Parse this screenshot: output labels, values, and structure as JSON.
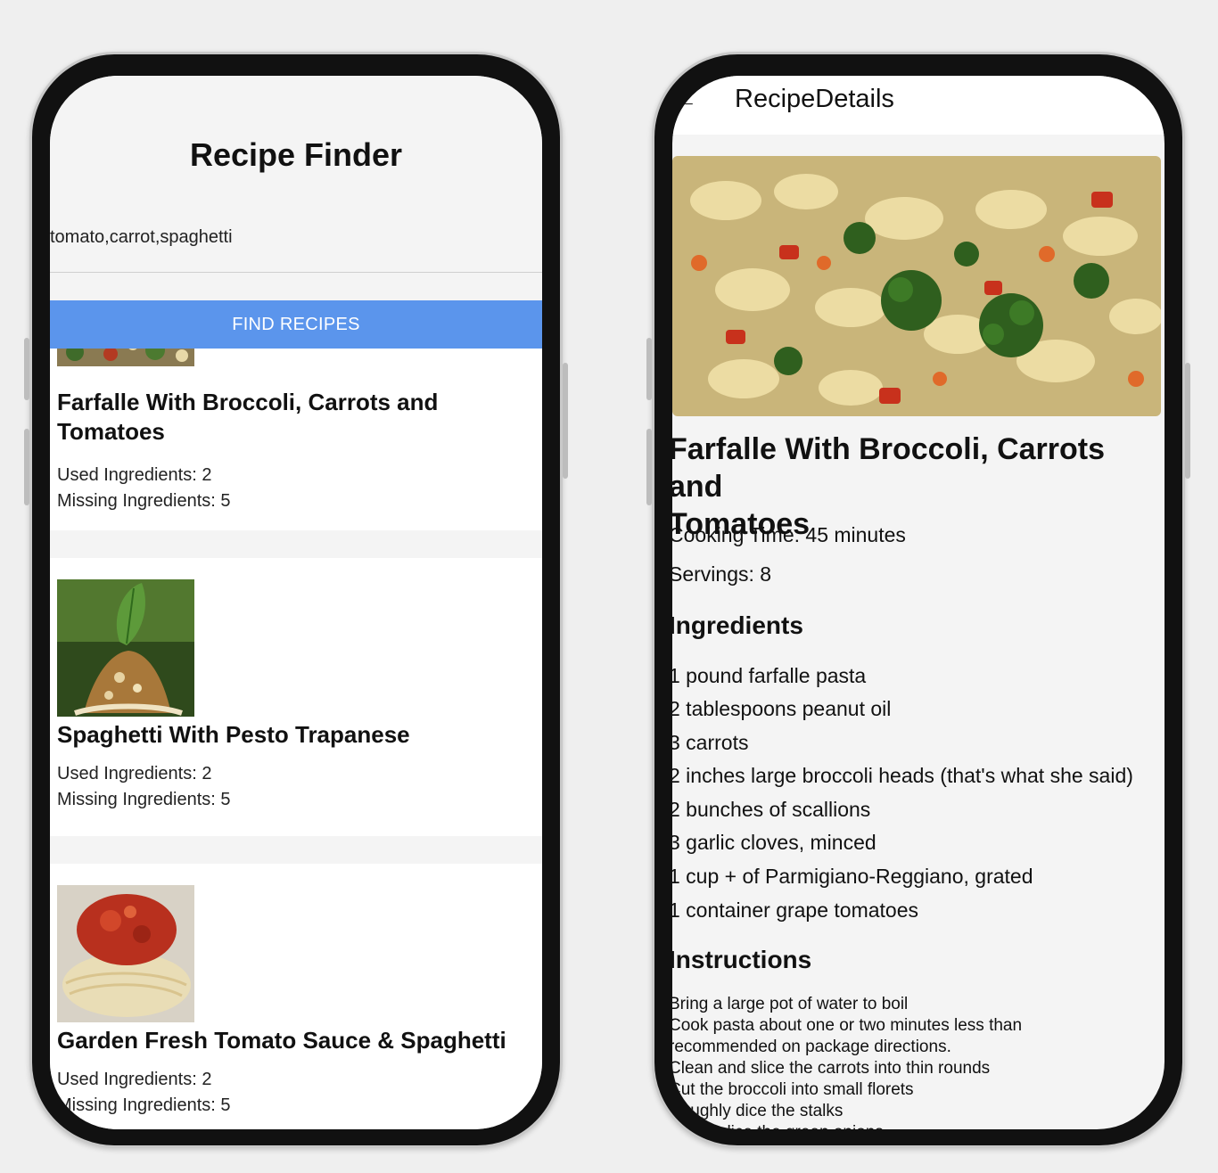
{
  "left": {
    "app_title": "Recipe Finder",
    "search_value": "tomato,carrot,spaghetti",
    "find_button": "FIND RECIPES",
    "recipes": [
      {
        "name_line1": "Farfalle With Broccoli, Carrots and",
        "name_line2": "Tomatoes",
        "used": "Used Ingredients: 2",
        "missing": "Missing Ingredients: 5"
      },
      {
        "name_line1": "Spaghetti With Pesto Trapanese",
        "used": "Used Ingredients: 2",
        "missing": "Missing Ingredients: 5"
      },
      {
        "name_line1": "Garden Fresh Tomato Sauce & Spaghetti",
        "used": "Used Ingredients: 2",
        "missing": "Missing Ingredients: 5"
      }
    ]
  },
  "right": {
    "screen_title": "RecipeDetails",
    "back_icon": "arrow-left-icon",
    "recipe_line1": "Farfalle With Broccoli, Carrots and",
    "recipe_line2": "Tomatoes",
    "cooking_time": "Cooking Time: 45 minutes",
    "servings": "Servings: 8",
    "ingredients_heading": "Ingredients",
    "ingredients": [
      "1 pound farfalle pasta",
      "2 tablespoons peanut oil",
      "3 carrots",
      "2 inches large broccoli heads (that's what she said)",
      "2 bunches of scallions",
      "3 garlic cloves, minced",
      "1 cup + of Parmigiano-Reggiano, grated",
      "1 container grape tomatoes"
    ],
    "instructions_heading": "Instructions",
    "instructions": [
      "Bring a large pot of water to boil",
      "Cook pasta about one or two minutes less than",
      "recommended on package directions.",
      "Clean and slice the carrots into thin rounds",
      "Cut the broccoli into small florets",
      "Roughly dice the stalks",
      "Thinly slice the green onions"
    ]
  },
  "colors": {
    "accent": "#5b95ec",
    "background": "#efefef",
    "screen": "#f4f4f4"
  }
}
